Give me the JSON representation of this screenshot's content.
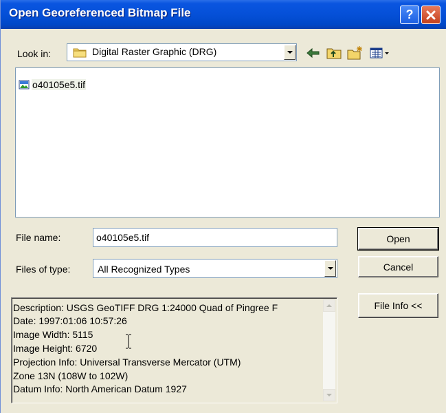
{
  "window": {
    "title": "Open Georeferenced Bitmap File"
  },
  "look_in": {
    "label": "Look in:",
    "value": "Digital Raster Graphic (DRG)"
  },
  "toolbar": {
    "icons": [
      "back-arrow-icon",
      "up-one-level-icon",
      "new-folder-icon",
      "view-menu-icon"
    ]
  },
  "files": [
    {
      "name": "o40105e5.tif",
      "icon": "tif-image-icon"
    }
  ],
  "file_name": {
    "label": "File name:",
    "value": "o40105e5.tif"
  },
  "file_type": {
    "label": "Files of type:",
    "value": "All Recognized Types"
  },
  "buttons": {
    "open": "Open",
    "cancel": "Cancel",
    "file_info": "File Info <<"
  },
  "info": {
    "lines": [
      "Description: USGS GeoTIFF DRG 1:24000 Quad of Pingree F",
      "Date: 1997:01:06 10:57:26",
      "Image Width: 5115",
      "Image Height: 6720",
      "Projection Info: Universal Transverse Mercator (UTM)",
      "Zone 13N (108W to 102W)",
      "Datum Info: North American Datum 1927"
    ]
  },
  "colors": {
    "titlebar": "#0550d8",
    "face": "#ece9d8",
    "border": "#7f9db9"
  }
}
